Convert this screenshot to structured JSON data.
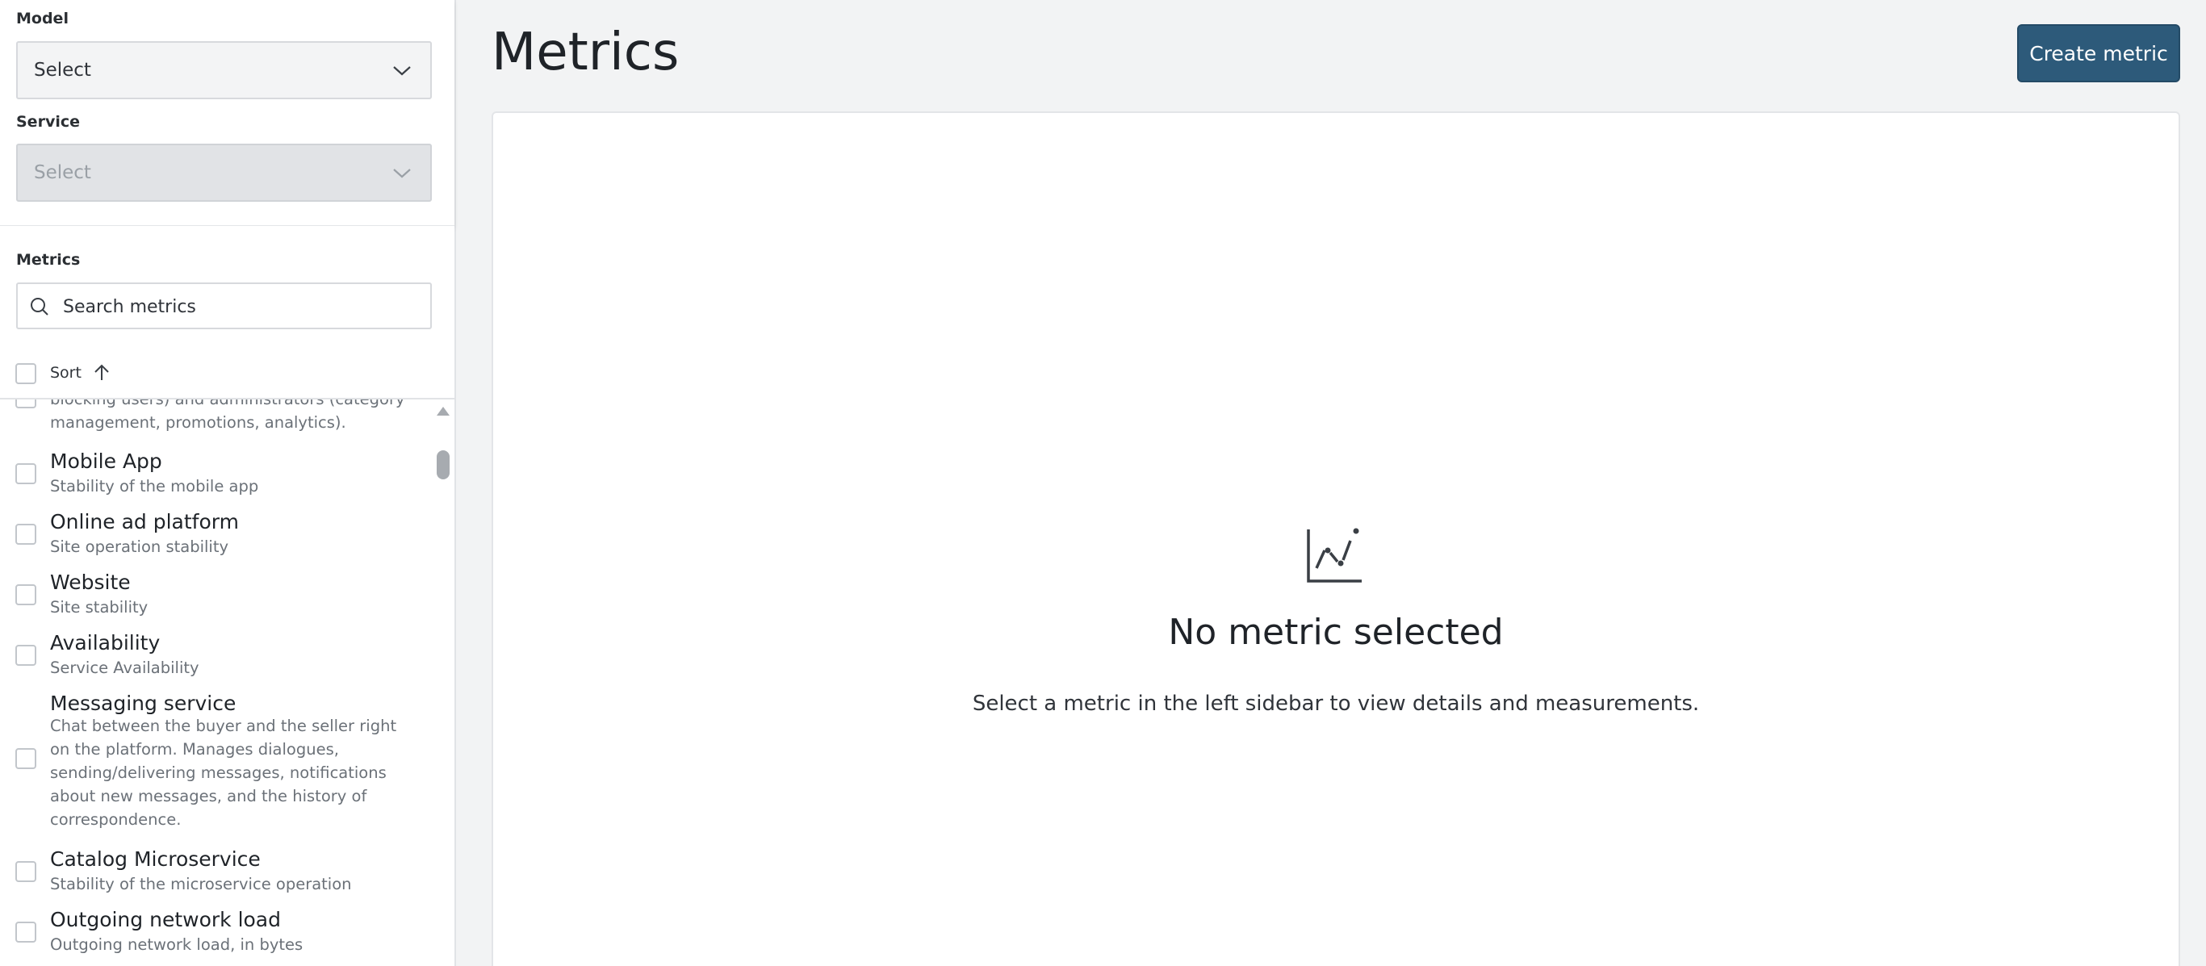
{
  "sidebar": {
    "model": {
      "label": "Model",
      "value": "Select"
    },
    "service": {
      "label": "Service",
      "value": "Select"
    },
    "metrics_label": "Metrics",
    "search": {
      "placeholder": "Search metrics"
    },
    "sort": {
      "label": "Sort"
    },
    "items": [
      {
        "title": "",
        "desc": "blocking users) and administrators (category management, promotions, analytics)."
      },
      {
        "title": "Mobile App",
        "desc": "Stability of the mobile app"
      },
      {
        "title": "Online ad platform",
        "desc": "Site operation stability"
      },
      {
        "title": "Website",
        "desc": "Site stability"
      },
      {
        "title": "Availability",
        "desc": "Service Availability"
      },
      {
        "title": "Messaging service",
        "desc": "Chat between the buyer and the seller right on the platform. Manages dialogues, sending/delivering messages, notifications about new messages, and the history of correspondence."
      },
      {
        "title": "Catalog Microservice",
        "desc": "Stability of the microservice operation"
      },
      {
        "title": "Outgoing network load",
        "desc": "Outgoing network load, in bytes"
      }
    ]
  },
  "main": {
    "title": "Metrics",
    "create_button": "Create metric",
    "empty": {
      "icon": "line-chart-icon",
      "title": "No metric selected",
      "hint": "Select a metric in the left sidebar to view details and measurements."
    }
  },
  "colors": {
    "primary_button": "#2d5a7a",
    "page_background": "#f2f3f4",
    "muted_text": "#6b7178"
  }
}
